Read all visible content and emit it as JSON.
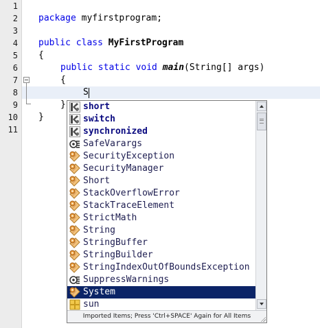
{
  "editor": {
    "line_numbers": [
      "1",
      "2",
      "3",
      "4",
      "5",
      "6",
      "7",
      "8",
      "9",
      "10",
      "11"
    ],
    "code": {
      "l2_kw": "package",
      "l2_rest": " myfirstprogram;",
      "l4_kw": "public class",
      "l4_name": "MyFirstProgram",
      "l5": "{",
      "l6_kw": "public static void",
      "l6_method": "main",
      "l6_rest": "(String[] args)",
      "l7": "{",
      "l8_typed": "S",
      "l9": "}",
      "l10": "}"
    }
  },
  "completion_popup": {
    "items": [
      {
        "label": "short",
        "icon": "keyword-icon",
        "kind": "keyword"
      },
      {
        "label": "switch",
        "icon": "keyword-icon",
        "kind": "keyword"
      },
      {
        "label": "synchronized",
        "icon": "keyword-icon",
        "kind": "keyword"
      },
      {
        "label": "SafeVarargs",
        "icon": "annotation-icon",
        "kind": "annotation"
      },
      {
        "label": "SecurityException",
        "icon": "class-icon",
        "kind": "class"
      },
      {
        "label": "SecurityManager",
        "icon": "class-icon",
        "kind": "class"
      },
      {
        "label": "Short",
        "icon": "class-icon",
        "kind": "class"
      },
      {
        "label": "StackOverflowError",
        "icon": "class-icon",
        "kind": "class"
      },
      {
        "label": "StackTraceElement",
        "icon": "class-icon",
        "kind": "class"
      },
      {
        "label": "StrictMath",
        "icon": "class-icon",
        "kind": "class"
      },
      {
        "label": "String",
        "icon": "class-icon",
        "kind": "class"
      },
      {
        "label": "StringBuffer",
        "icon": "class-icon",
        "kind": "class"
      },
      {
        "label": "StringBuilder",
        "icon": "class-icon",
        "kind": "class"
      },
      {
        "label": "StringIndexOutOfBoundsException",
        "icon": "class-icon",
        "kind": "class"
      },
      {
        "label": "SuppressWarnings",
        "icon": "annotation-icon",
        "kind": "annotation"
      },
      {
        "label": "System",
        "icon": "class-icon",
        "kind": "class",
        "selected": true
      },
      {
        "label": "sun",
        "icon": "package-icon",
        "kind": "package"
      }
    ],
    "footer": "Imported Items; Press 'Ctrl+SPACE' Again for All Items"
  },
  "colors": {
    "keyword": "#0000e6",
    "selection": "#0b2467",
    "caret_line": "#e9eff8",
    "gutter": "#ececec"
  }
}
